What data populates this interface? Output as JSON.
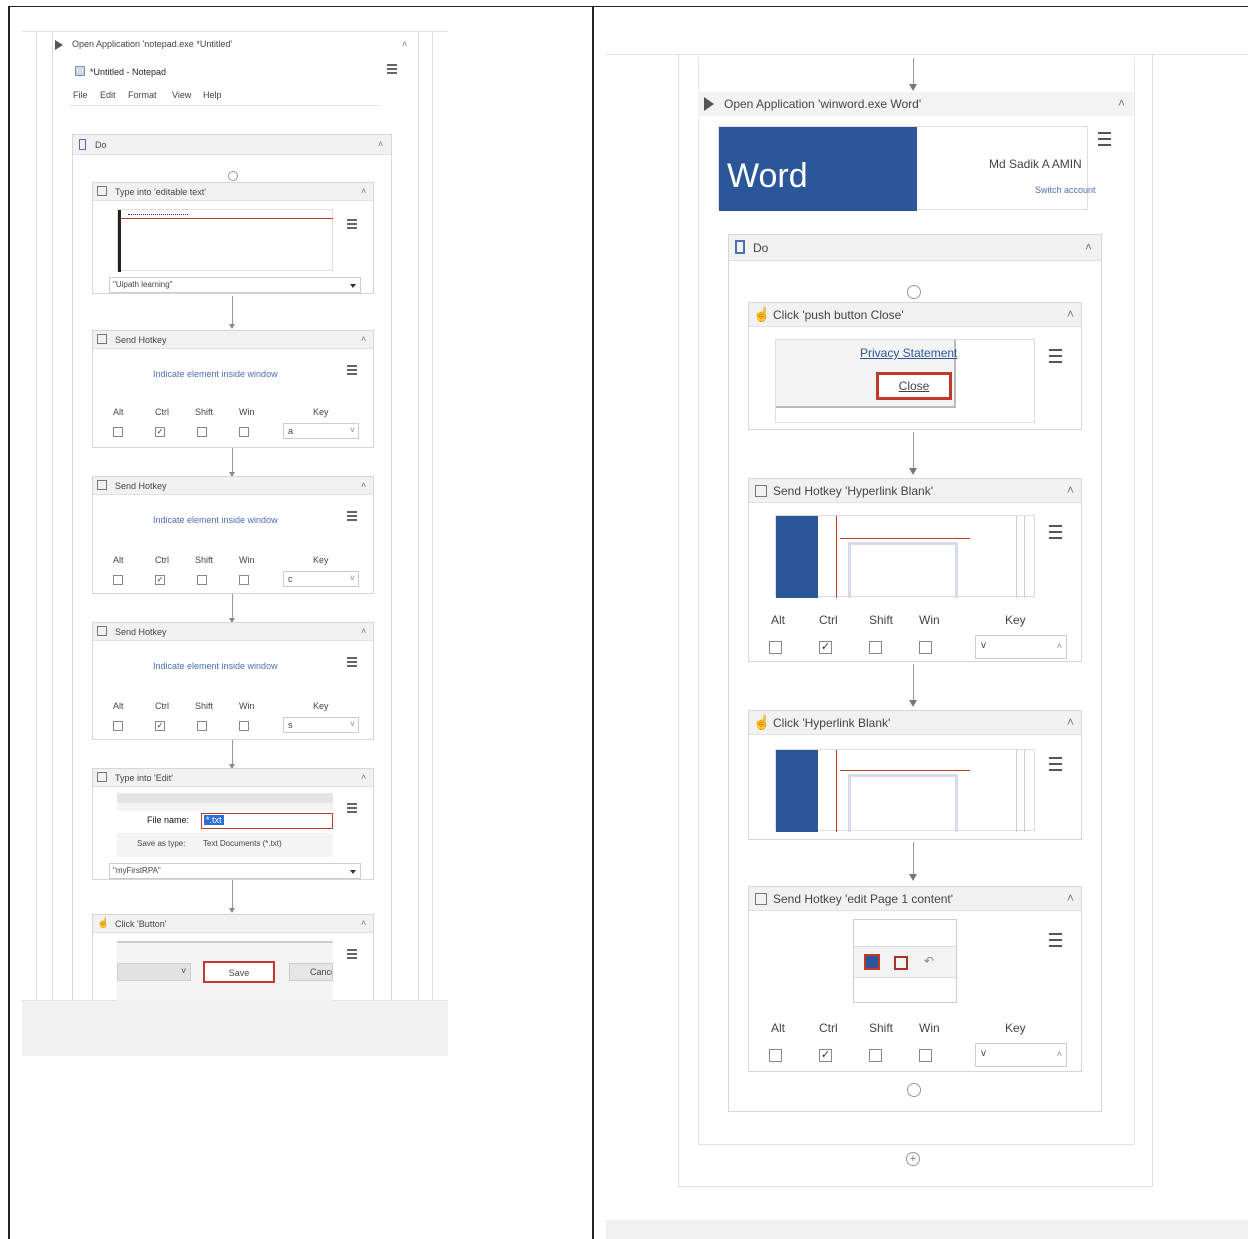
{
  "left": {
    "open_app_title": "Open Application 'notepad.exe *Untitled'",
    "notepad_title": "*Untitled - Notepad",
    "menu": [
      "File",
      "Edit",
      "Format",
      "View",
      "Help"
    ],
    "do_label": "Do",
    "type_into_1": {
      "title": "Type into 'editable text'",
      "value": "\"Uipath learning\""
    },
    "hotkey_1": {
      "title": "Send Hotkey",
      "indicate": "Indicate element inside window",
      "key": "a"
    },
    "hotkey_2": {
      "title": "Send Hotkey",
      "indicate": "Indicate element inside window",
      "key": "c"
    },
    "hotkey_3": {
      "title": "Send Hotkey",
      "indicate": "Indicate element inside window",
      "key": "s"
    },
    "modifiers": [
      "Alt",
      "Ctrl",
      "Shift",
      "Win"
    ],
    "key_label": "Key",
    "type_into_2": {
      "title": "Type into 'Edit'",
      "file_name_label": "File name:",
      "file_name_value": "*.txt",
      "save_type_label": "Save as type:",
      "save_type_value": "Text Documents (*.txt)",
      "value": "\"myFirstRPA\""
    },
    "click_button": {
      "title": "Click 'Button'",
      "save": "Save",
      "cancel": "Cancel"
    }
  },
  "right": {
    "open_app_title": "Open Application 'winword.exe Word'",
    "word_label": "Word",
    "word_user": "Md Sadik A AMIN",
    "word_signout": "Switch account",
    "do_label": "Do",
    "click_close": {
      "title": "Click 'push button  Close'",
      "privacy": "Privacy Statement",
      "close": "Close"
    },
    "hotkey_hyperlink": {
      "title": "Send Hotkey 'Hyperlink Blank'",
      "key": "v"
    },
    "click_hyperlink": {
      "title": "Click 'Hyperlink Blank'"
    },
    "hotkey_edit": {
      "title": "Send Hotkey 'edit  Page 1 content'",
      "key": "v"
    },
    "modifiers": [
      "Alt",
      "Ctrl",
      "Shift",
      "Win"
    ],
    "key_label": "Key",
    "colors": {
      "word_blue": "#2b579a",
      "highlight_red": "#c0392b"
    }
  }
}
